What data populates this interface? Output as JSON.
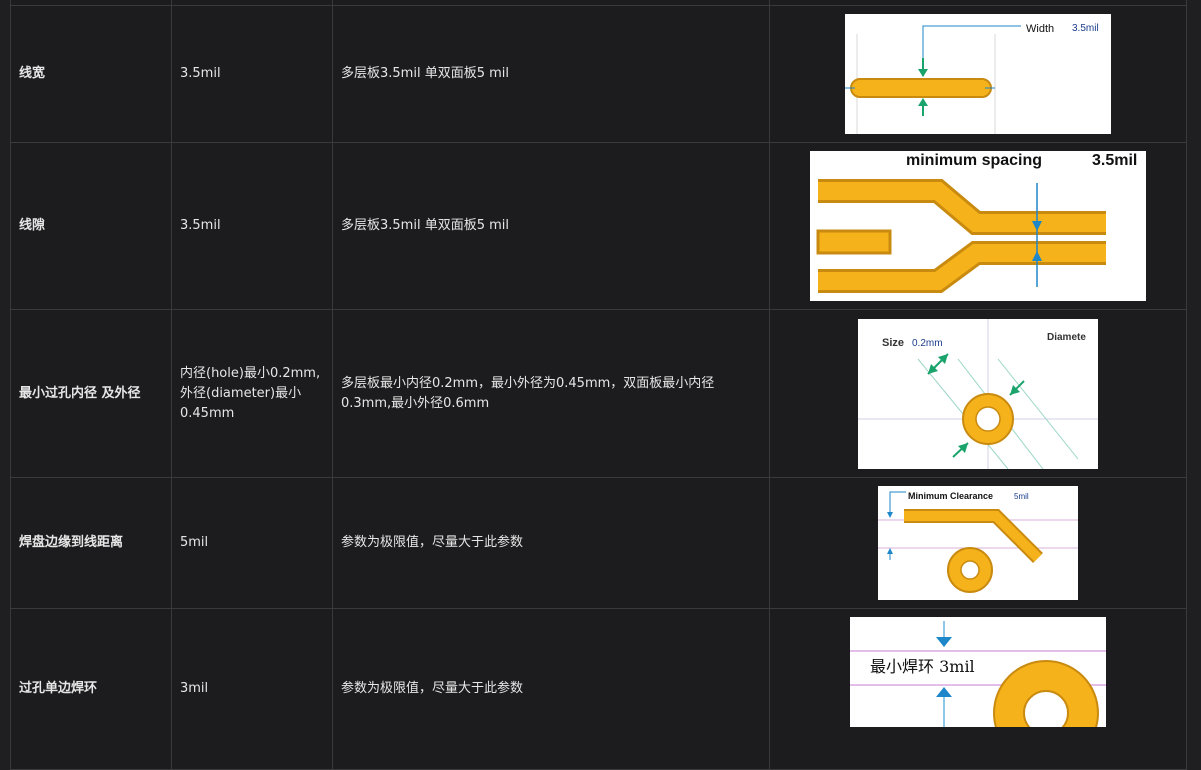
{
  "rows": [
    {
      "param": "线宽",
      "value": "3.5mil",
      "desc": "多层板3.5mil 单双面板5 mil",
      "image": {
        "label": "Width",
        "value": "3.5mil"
      }
    },
    {
      "param": "线隙",
      "value": "3.5mil",
      "desc": "多层板3.5mil 单双面板5 mil",
      "image": {
        "label": "minimum spacing",
        "value": "3.5mil"
      }
    },
    {
      "param": "最小过孔内径 及外径",
      "value": "内径(hole)最小0.2mm,外径(diameter)最小0.45mm",
      "desc": "多层板最小内径0.2mm，最小外径为0.45mm，双面板最小内径0.3mm,最小外径0.6mm",
      "image": {
        "label": "Size",
        "value": "0.2mm",
        "label2": "Diamete"
      }
    },
    {
      "param": "焊盘边缘到线距离",
      "value": "5mil",
      "desc": "参数为极限值，尽量大于此参数",
      "image": {
        "label": "Minimum Clearance",
        "value": "5mil"
      }
    },
    {
      "param": "过孔单边焊环",
      "value": "3mil",
      "desc": "参数为极限值，尽量大于此参数",
      "image": {
        "label": "最小焊环 3mil"
      }
    }
  ],
  "colors": {
    "copper": "#f5b21a",
    "copper_edge": "#c98a10",
    "arrow_green": "#1aa36b",
    "arrow_blue": "#1d87c9"
  }
}
